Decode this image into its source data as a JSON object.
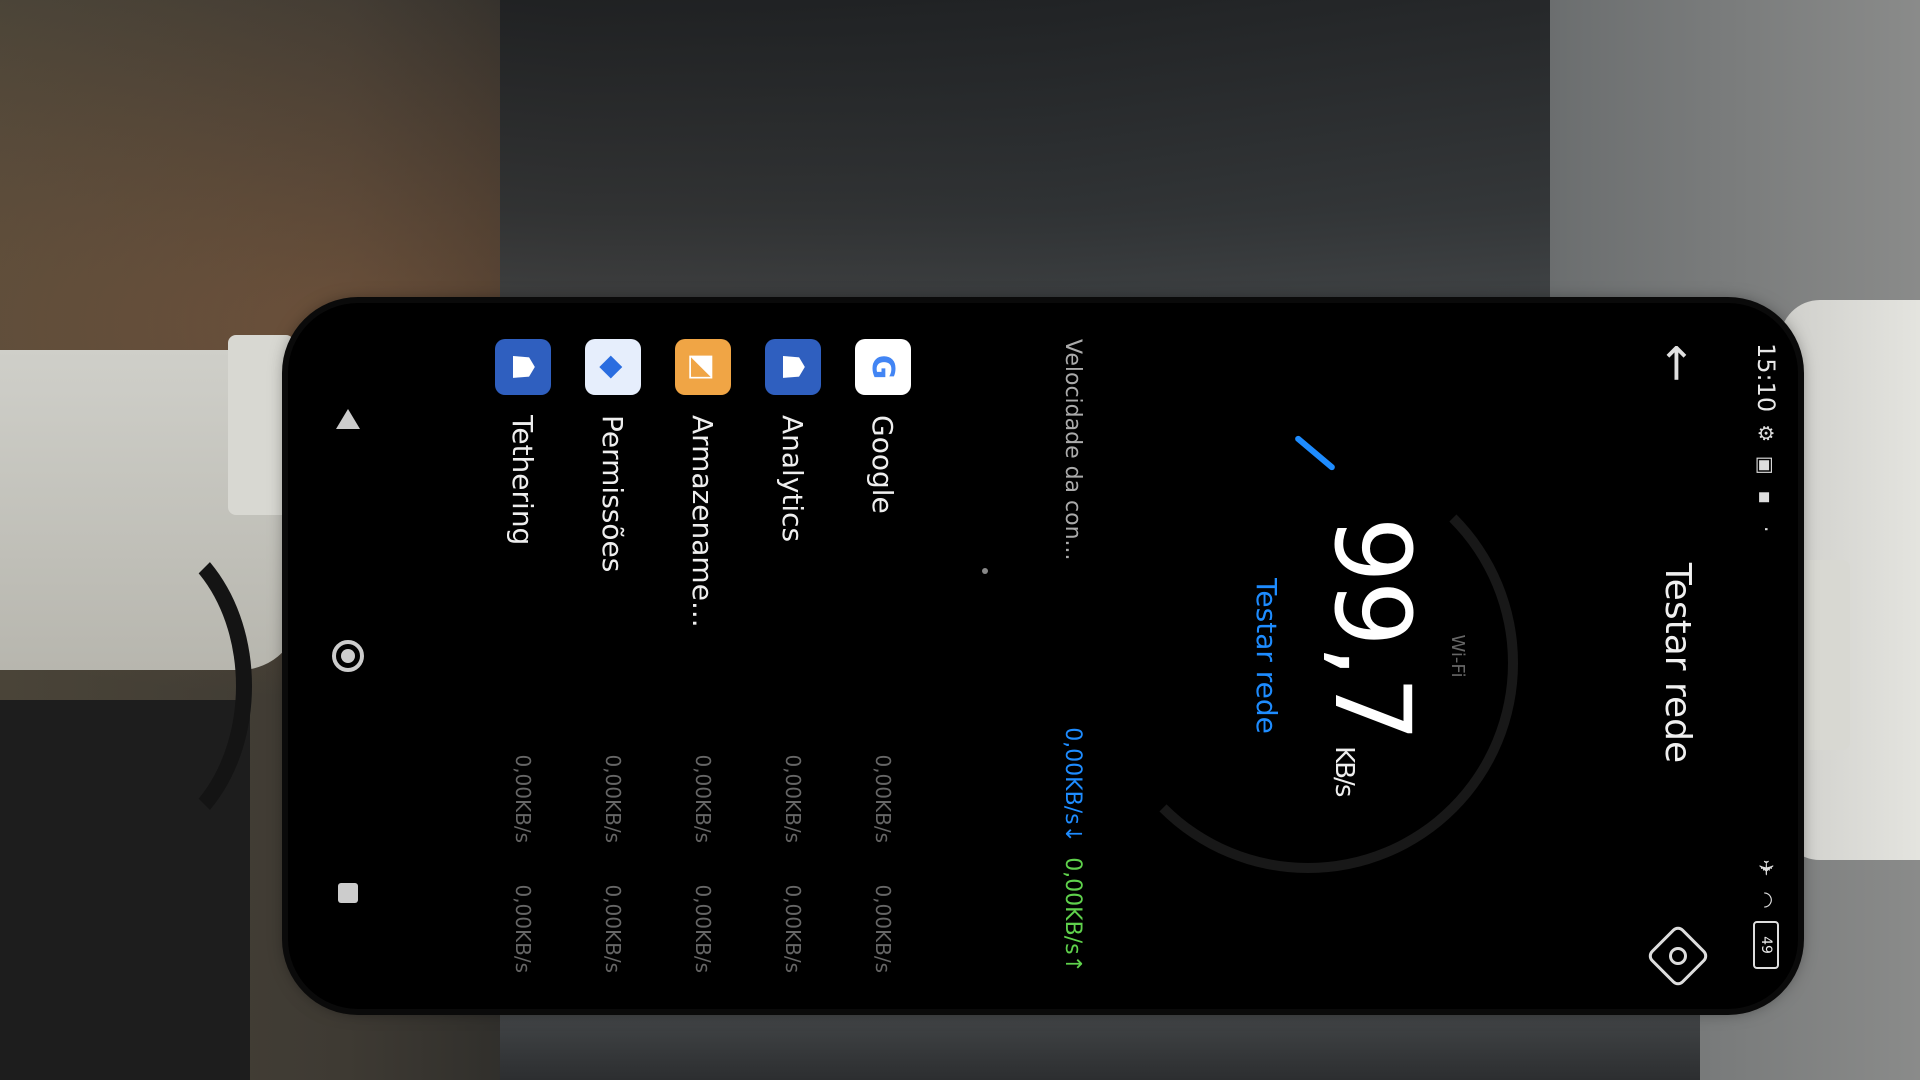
{
  "status_bar": {
    "time": "15:10",
    "battery": "49"
  },
  "app_bar": {
    "title": "Testar rede"
  },
  "speed": {
    "network_type": "Wi-Fi",
    "value": "99,7",
    "unit": "KB/s",
    "test_label": "Testar rede"
  },
  "list_header": {
    "label": "Velocidade da con...",
    "download": "0,00KB/s↓",
    "upload": "0,00KB/s↑"
  },
  "apps": [
    {
      "name": "Google",
      "down": "0,00KB/s",
      "up": "0,00KB/s",
      "icon": "google-icon",
      "color": "#ffffff"
    },
    {
      "name": "Analytics",
      "down": "0,00KB/s",
      "up": "0,00KB/s",
      "icon": "android-icon",
      "color": "#2f5fbf"
    },
    {
      "name": "Armazename...",
      "down": "0,00KB/s",
      "up": "0,00KB/s",
      "icon": "storage-icon",
      "color": "#f0a545"
    },
    {
      "name": "Permissões",
      "down": "0,00KB/s",
      "up": "0,00KB/s",
      "icon": "permissions-icon",
      "color": "#e6eefc"
    },
    {
      "name": "Tethering",
      "down": "0,00KB/s",
      "up": "0,00KB/s",
      "icon": "android-icon",
      "color": "#2f5fbf"
    }
  ],
  "colors": {
    "accent_blue": "#1e8cff",
    "upload_green": "#5fd14c"
  }
}
